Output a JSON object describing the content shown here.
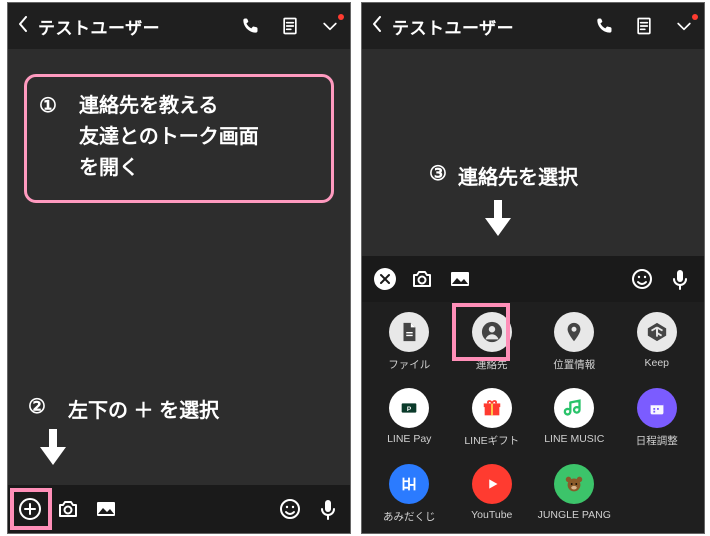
{
  "header": {
    "title": "テストユーザー"
  },
  "steps": {
    "s1_num": "①",
    "s1_line1": "連絡先を教える",
    "s1_line2": "友達とのトーク画面",
    "s1_line3": "を開く",
    "s2_num": "②",
    "s2_text": "左下の ＋ を選択",
    "s3_num": "③",
    "s3_text": "連絡先を選択"
  },
  "drawer": {
    "items": [
      {
        "label": "ファイル",
        "icon": "file-icon",
        "bg": "plain"
      },
      {
        "label": "連絡先",
        "icon": "contact-icon",
        "bg": "plain"
      },
      {
        "label": "位置情報",
        "icon": "location-icon",
        "bg": "plain"
      },
      {
        "label": "Keep",
        "icon": "keep-icon",
        "bg": "plain"
      },
      {
        "label": "LINE Pay",
        "icon": "linepay-icon",
        "bg": "linepay"
      },
      {
        "label": "LINEギフト",
        "icon": "gift-icon",
        "bg": "gift"
      },
      {
        "label": "LINE MUSIC",
        "icon": "music-icon",
        "bg": "music"
      },
      {
        "label": "日程調整",
        "icon": "schedule-icon",
        "bg": "schedule"
      },
      {
        "label": "あみだくじ",
        "icon": "lottery-icon",
        "bg": "lottery"
      },
      {
        "label": "YouTube",
        "icon": "youtube-icon",
        "bg": "youtube"
      },
      {
        "label": "JUNGLE PANG",
        "icon": "jungle-icon",
        "bg": "jungle"
      }
    ]
  },
  "colors": {
    "accent_pink": "#ff8fb8",
    "bg_dark": "#2d2d2d",
    "bg_header": "#1f1f1f"
  }
}
